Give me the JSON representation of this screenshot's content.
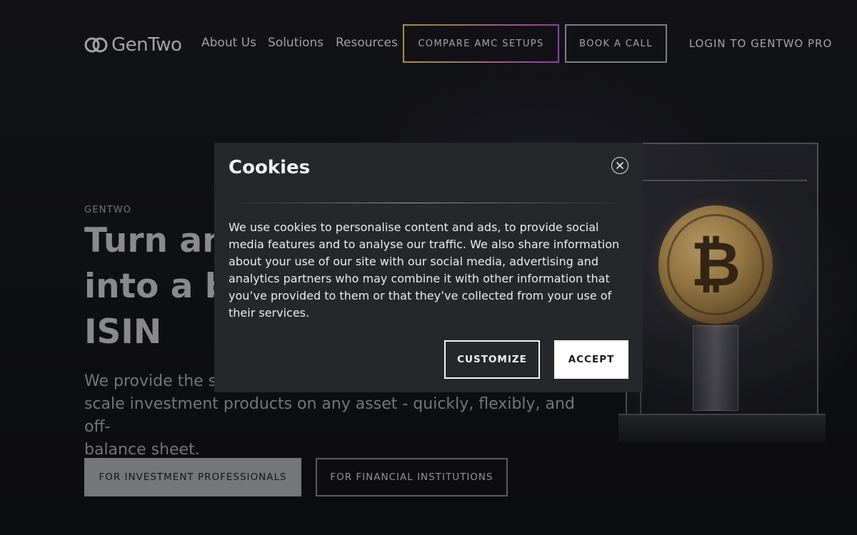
{
  "nav": {
    "logo_text": "GenTwo",
    "links": [
      "About Us",
      "Solutions",
      "Resources"
    ],
    "compare_label": "COMPARE AMC SETUPS",
    "book_label": "BOOK A CALL",
    "login_label": "LOGIN TO GENTWO PRO"
  },
  "hero": {
    "eyebrow": "GENTWO",
    "title_lines": [
      "Turn any",
      "into a ba",
      "ISIN"
    ],
    "subtitle_lines": [
      "We provide the se",
      "scale investment products on any asset - quickly, flexibly, and off-",
      "balance sheet."
    ],
    "primary_button": "FOR INVESTMENT PROFESSIONALS",
    "secondary_button": "FOR FINANCIAL INSTITUTIONS"
  },
  "showcase": {
    "coin_symbol": "₿"
  },
  "cookie_modal": {
    "title": "Cookies",
    "close_icon": "close-icon",
    "body": "We use cookies to personalise content and ads, to provide social media features and to analyse our traffic. We also share information about your use of our site with our social media, advertising and analytics partners who may combine it with other information that you’ve provided to them or that they’ve collected from your use of their services.",
    "customize_label": "CUSTOMIZE",
    "accept_label": "ACCEPT"
  },
  "colors": {
    "background": "#121317",
    "modal_bg": "#25272b",
    "compare_gradient_start": "#c9b735",
    "compare_gradient_end": "#b24bd3",
    "primary_button_bg": "#8f9094"
  }
}
